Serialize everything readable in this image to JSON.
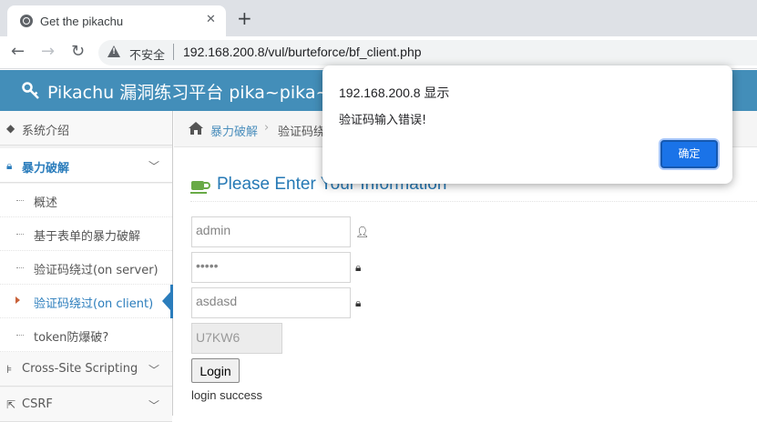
{
  "browser": {
    "tab_title": "Get the pikachu",
    "insecure_label": "不安全",
    "url": "192.168.200.8/vul/burteforce/bf_client.php"
  },
  "navbar": {
    "brand": "Pikachu 漏洞练习平台 pika~pika~",
    "brand_color": "#438eb9"
  },
  "sidebar": {
    "items": [
      {
        "label": "系统介绍",
        "icon": "tag-icon"
      },
      {
        "label": "暴力破解",
        "icon": "lock-icon",
        "expanded": true
      },
      {
        "label": "Cross-Site Scripting",
        "icon": "sitemap-icon"
      },
      {
        "label": "CSRF",
        "icon": "share-icon"
      }
    ],
    "subitems": [
      {
        "label": "概述"
      },
      {
        "label": "基于表单的暴力破解"
      },
      {
        "label": "验证码绕过(on server)"
      },
      {
        "label": "验证码绕过(on client)",
        "active": true
      },
      {
        "label": "token防爆破?"
      }
    ]
  },
  "breadcrumb": {
    "link": "暴力破解",
    "current": "验证码绕过"
  },
  "page": {
    "title": "Please Enter Your Information"
  },
  "form": {
    "username": "admin",
    "password": "•••••",
    "vcode": "asdasd",
    "captcha": "U7KW6",
    "login_label": "Login",
    "result": "login success"
  },
  "dialog": {
    "title": "192.168.200.8 显示",
    "message": "验证码输入错误!",
    "ok_label": "确定"
  }
}
